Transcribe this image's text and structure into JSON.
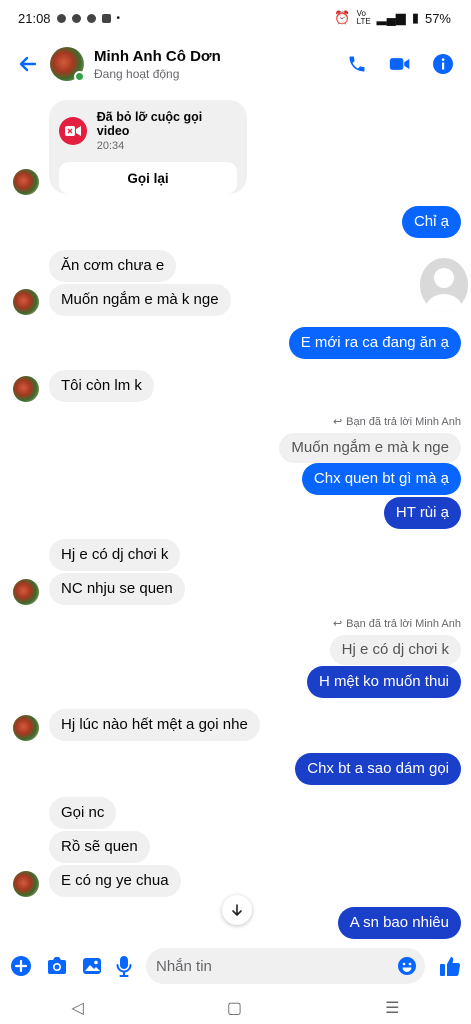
{
  "status_bar": {
    "time": "21:08",
    "network": "Vo LTE",
    "battery": "57%"
  },
  "header": {
    "contact_name": "Minh Anh Cô Dơn",
    "contact_status": "Đang hoạt động"
  },
  "call_card": {
    "title": "Đã bỏ lỡ cuộc gọi video",
    "time": "20:34",
    "button": "Gọi lại"
  },
  "messages": {
    "m1": "Chỉ ạ",
    "m2": "Ăn cơm chưa e",
    "m3": "Muốn ngắm e mà k nge",
    "m4": "E mới ra ca đang ăn ạ",
    "m5": "Tôi còn lm k",
    "reply_note_1": "Bạn đã trả lời Minh Anh",
    "quote_1": "Muốn ngắm e mà k nge",
    "m6": "Chx quen bt gì mà ạ",
    "m7": "HT rùi ạ",
    "m8": "Hj e có dj chơi k",
    "m9": "NC nhju se quen",
    "reply_note_2": "Bạn đã trả lời Minh Anh",
    "quote_2": "Hj e có dj chơi k",
    "m10": "H mệt ko muốn thui",
    "m11": "Hj lúc nào hết mệt a gọi nhe",
    "m12": "Chx bt a sao dám gọi",
    "m13": "Gọi nc",
    "m14": "Rồ sẽ quen",
    "m15": "E có ng ye chua",
    "m16": "A sn bao nhiêu"
  },
  "composer": {
    "placeholder": "Nhắn tin"
  },
  "nav": {
    "back": "◁",
    "home": "▢",
    "recents": "☰"
  }
}
